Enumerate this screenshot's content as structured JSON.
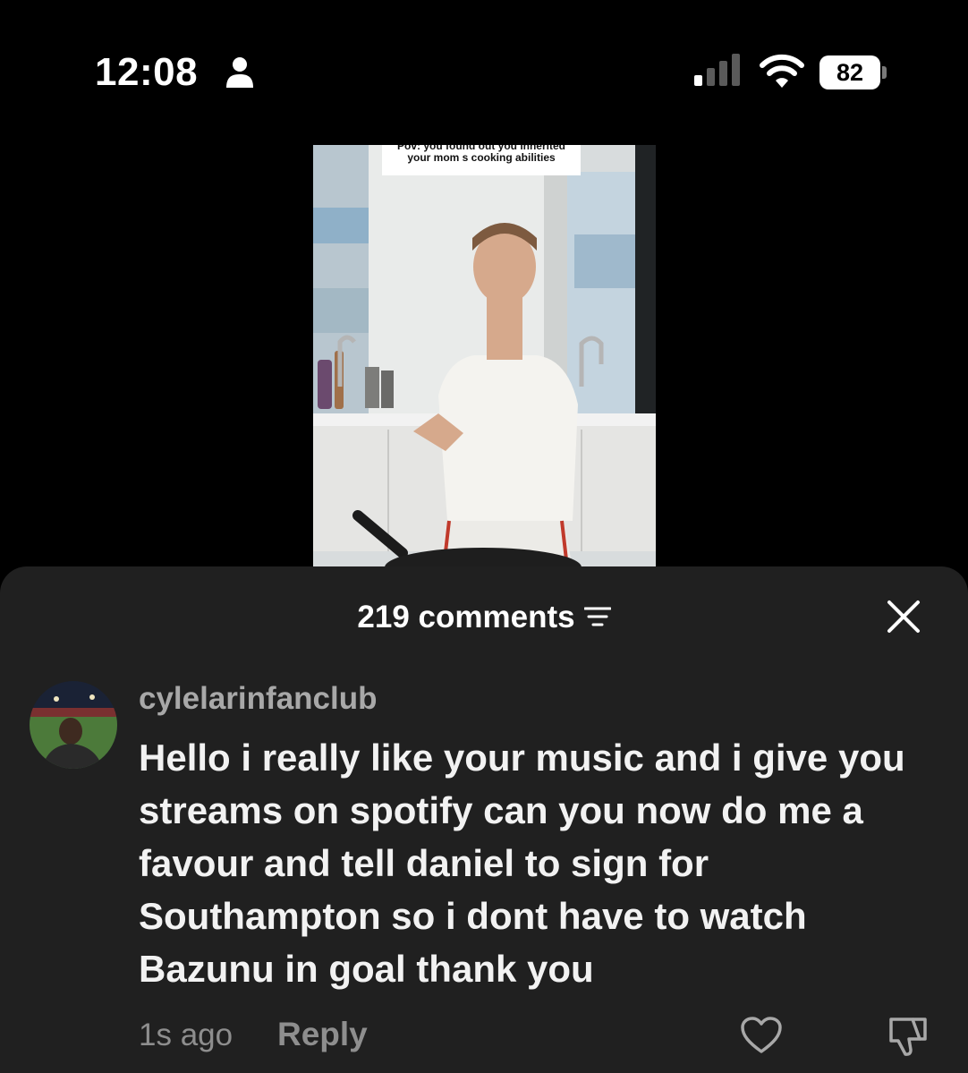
{
  "status_bar": {
    "time": "12:08",
    "battery_percent": "82",
    "icons": [
      "person-icon",
      "signal-icon",
      "wifi-icon",
      "battery-icon"
    ]
  },
  "video": {
    "caption_line1": "Pov: you found out you inherited",
    "caption_line2": "your mom s cooking abilities"
  },
  "comments_sheet": {
    "title": "219 comments",
    "filter_icon": "filter-icon",
    "close_icon": "close-icon",
    "comments": [
      {
        "username": "cylelarinfanclub",
        "text": "Hello i really like your music and i give you streams on spotify can you now do me a favour and tell daniel to sign for Southampton so i dont have to watch Bazunu in goal thank you",
        "time": "1s ago",
        "reply_label": "Reply",
        "like_icon": "heart-icon",
        "dislike_icon": "dislike-icon"
      }
    ]
  },
  "colors": {
    "background": "#000000",
    "sheet": "#202020",
    "secondary_text": "#8e8e8e",
    "username_text": "#a8a8a8"
  }
}
